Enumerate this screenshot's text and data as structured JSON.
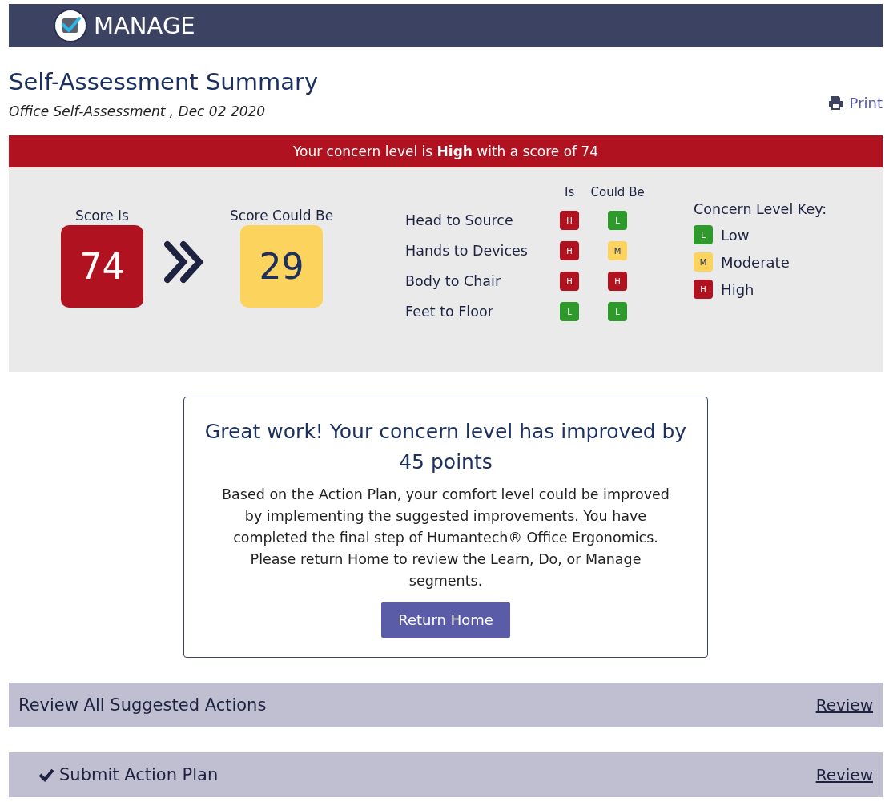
{
  "header": {
    "title": "MANAGE"
  },
  "page": {
    "title": "Self-Assessment Summary",
    "subtitle": "Office Self-Assessment , Dec 02 2020",
    "print": "Print"
  },
  "banner": {
    "text": "Your concern level is **High** with a score of 74",
    "kind": "high"
  },
  "scores": [
    {
      "label": "Score Is",
      "value": "74",
      "kind": "high"
    },
    {
      "label": "Score Could Be",
      "value": "29",
      "kind": "moderate"
    }
  ],
  "factors": {
    "columns": [
      "Is",
      "Could Be"
    ],
    "rows": [
      {
        "name": "Head to Source",
        "is": {
          "label": "H",
          "kind": "high"
        },
        "could_be": {
          "label": "L",
          "kind": "low"
        }
      },
      {
        "name": "Hands to Devices",
        "is": {
          "label": "H",
          "kind": "high"
        },
        "could_be": {
          "label": "M",
          "kind": "moderate"
        }
      },
      {
        "name": "Body to Chair",
        "is": {
          "label": "H",
          "kind": "high"
        },
        "could_be": {
          "label": "H",
          "kind": "high"
        }
      },
      {
        "name": "Feet to Floor",
        "is": {
          "label": "L",
          "kind": "low"
        },
        "could_be": {
          "label": "L",
          "kind": "low"
        }
      }
    ]
  },
  "key": {
    "title": "Concern Level Key:",
    "items": [
      {
        "badge": "L",
        "label": "Low",
        "kind": "low"
      },
      {
        "badge": "M",
        "label": "Moderate",
        "kind": "moderate"
      },
      {
        "badge": "H",
        "label": "High",
        "kind": "high"
      }
    ]
  },
  "message": {
    "title": "Great work! Your concern level has improved by 45 points",
    "body": "Based on the Action Plan, your comfort level could be improved by implementing the suggested improvements. You have completed the final step of Humantech® Office Ergonomics. Please return Home to review the Learn, Do, or Manage segments.",
    "button": "Return Home"
  },
  "sections": [
    {
      "title": "Review All Suggested Actions",
      "link": "Review",
      "checked": false
    },
    {
      "title": "Submit Action Plan",
      "link": "Review",
      "checked": true
    }
  ]
}
